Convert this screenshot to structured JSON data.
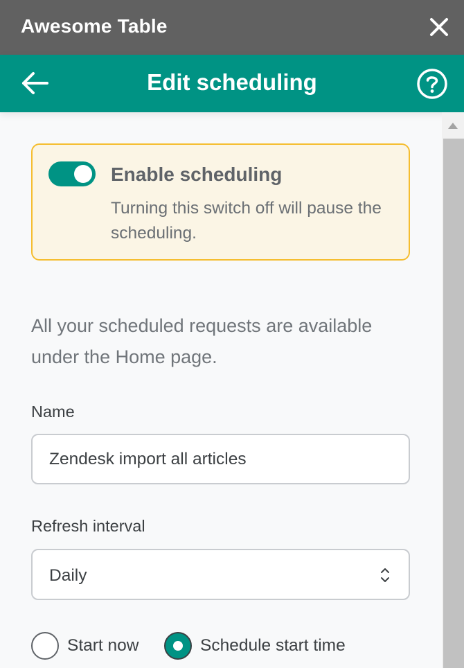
{
  "window": {
    "title": "Awesome Table",
    "close_icon": "close-icon"
  },
  "header": {
    "title": "Edit scheduling",
    "back_icon": "arrow-left-icon",
    "help_icon": "help-circle-icon"
  },
  "notice": {
    "toggle_state": "on",
    "title": "Enable scheduling",
    "description": "Turning this switch off will pause the scheduling."
  },
  "info_text": "All your scheduled requests are available under the Home page.",
  "form": {
    "name_label": "Name",
    "name_value": "Zendesk import all articles",
    "interval_label": "Refresh interval",
    "interval_value": "Daily",
    "start_options": [
      {
        "label": "Start now",
        "selected": false
      },
      {
        "label": "Schedule start time",
        "selected": true
      }
    ]
  },
  "colors": {
    "titlebar": "#616161",
    "accent": "#009384",
    "notice_bg": "#fbf5e5",
    "notice_border": "#f5bd2f"
  }
}
